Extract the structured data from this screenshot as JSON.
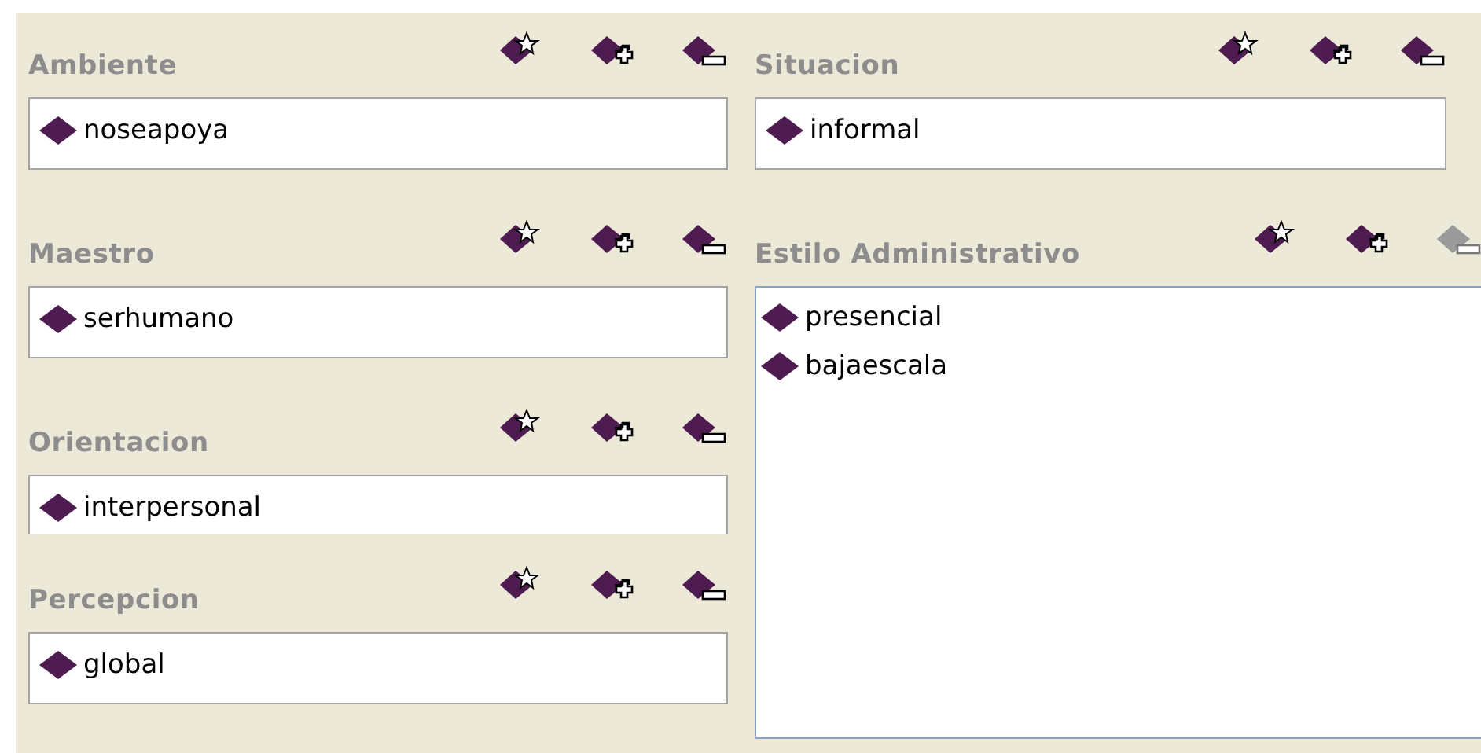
{
  "columns": [
    {
      "sections": [
        {
          "title": "Ambiente",
          "kind": "single",
          "values": [
            "noseapoya"
          ],
          "actions": [
            {
              "kind": "create",
              "disabled": false
            },
            {
              "kind": "add",
              "disabled": false
            },
            {
              "kind": "remove",
              "disabled": false
            }
          ]
        },
        {
          "title": "Maestro",
          "kind": "single",
          "values": [
            "serhumano"
          ],
          "actions": [
            {
              "kind": "create",
              "disabled": false
            },
            {
              "kind": "add",
              "disabled": false
            },
            {
              "kind": "remove",
              "disabled": false
            }
          ]
        },
        {
          "title": "Orientacion",
          "kind": "single",
          "values": [
            "interpersonal"
          ],
          "actions": [
            {
              "kind": "create",
              "disabled": false
            },
            {
              "kind": "add",
              "disabled": false
            },
            {
              "kind": "remove",
              "disabled": false
            }
          ]
        },
        {
          "title": "Percepcion",
          "kind": "single",
          "values": [
            "global"
          ],
          "actions": [
            {
              "kind": "create",
              "disabled": false
            },
            {
              "kind": "add",
              "disabled": false
            },
            {
              "kind": "remove",
              "disabled": false
            }
          ]
        }
      ]
    },
    {
      "sections": [
        {
          "title": "Situacion",
          "kind": "single",
          "values": [
            "informal"
          ],
          "actions": [
            {
              "kind": "create",
              "disabled": false
            },
            {
              "kind": "add",
              "disabled": false
            },
            {
              "kind": "remove",
              "disabled": false
            }
          ]
        },
        {
          "title": "Estilo Administrativo",
          "kind": "list",
          "values": [
            "presencial",
            "bajaescala"
          ],
          "actions": [
            {
              "kind": "create",
              "disabled": false
            },
            {
              "kind": "add",
              "disabled": false
            },
            {
              "kind": "remove",
              "disabled": true
            }
          ]
        }
      ]
    }
  ]
}
